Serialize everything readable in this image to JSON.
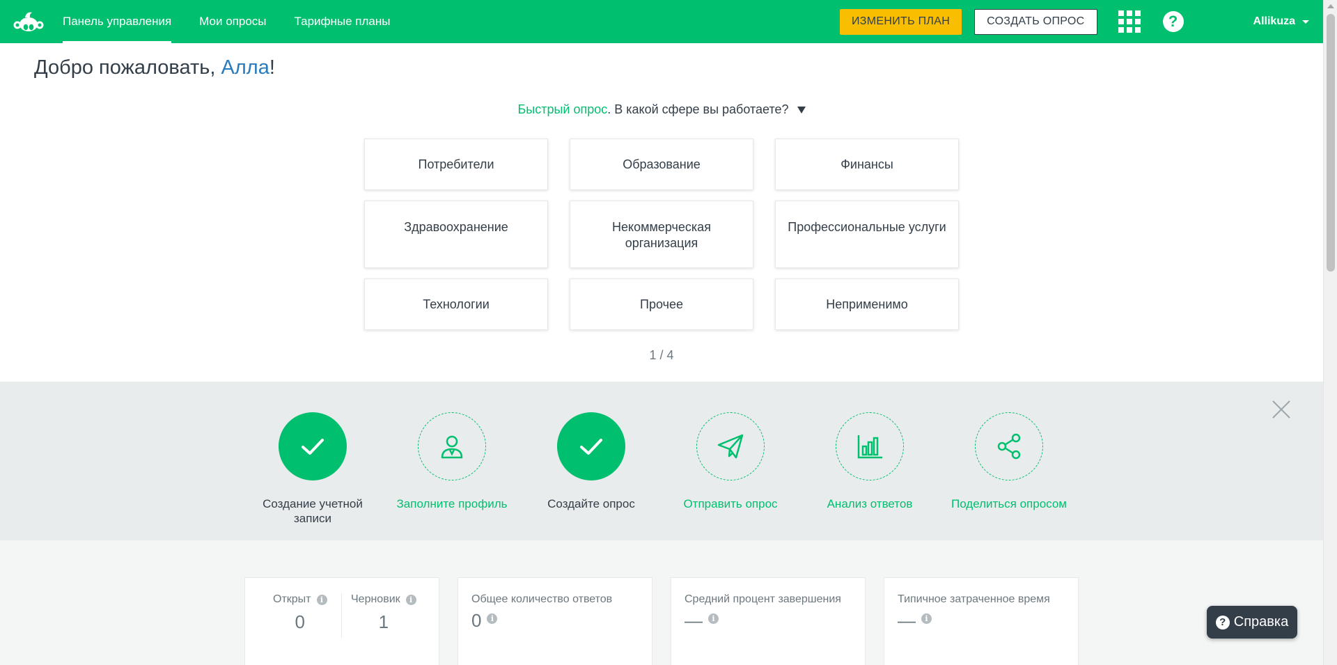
{
  "nav": {
    "logo_icon": "surveymonkey-logo-icon",
    "links": [
      {
        "label": "Панель управления",
        "active": true
      },
      {
        "label": "Мои опросы",
        "active": false
      },
      {
        "label": "Тарифные планы",
        "active": false
      }
    ],
    "upgrade_label": "ИЗМЕНИТЬ ПЛАН",
    "create_label": "СОЗДАТЬ ОПРОС",
    "apps_icon": "apps-grid-icon",
    "help_icon": "question-icon",
    "help_glyph": "?",
    "username": "Allikuza"
  },
  "welcome": {
    "greeting": "Добро пожаловать, ",
    "name": "Алла",
    "suffix": "!"
  },
  "quick_survey": {
    "link": "Быстрый опрос",
    "question": ". В какой сфере вы работаете?",
    "options": [
      "Потребители",
      "Образование",
      "Финансы",
      "Здравоохранение",
      "Некоммерческая организация",
      "Профессиональные услуги",
      "Технологии",
      "Прочее",
      "Неприменимо"
    ],
    "pager": "1 / 4"
  },
  "onboarding": {
    "steps": [
      {
        "label": "Создание учетной записи",
        "done": true,
        "icon": "check-icon"
      },
      {
        "label": "Заполните профиль",
        "done": false,
        "icon": "user-icon"
      },
      {
        "label": "Создайте опрос",
        "done": true,
        "icon": "check-icon"
      },
      {
        "label": "Отправить опрос",
        "done": false,
        "icon": "send-icon"
      },
      {
        "label": "Анализ ответов",
        "done": false,
        "icon": "bar-chart-icon"
      },
      {
        "label": "Поделиться опросом",
        "done": false,
        "icon": "share-icon"
      }
    ]
  },
  "stats": {
    "open_label": "Открыт",
    "open_value": "0",
    "draft_label": "Черновик",
    "draft_value": "1",
    "total_label": "Общее количество ответов",
    "total_value": "0",
    "completion_label": "Средний процент завершения",
    "completion_value": "—",
    "time_label": "Типичное затраченное время",
    "time_value": "—",
    "info_glyph": "i"
  },
  "help_button": {
    "glyph": "?",
    "label": "Справка"
  },
  "colors": {
    "brand_green": "#00bf6f",
    "upgrade_yellow": "#f9be00",
    "dark": "#333e48",
    "link_blue": "#2a7bbd"
  }
}
